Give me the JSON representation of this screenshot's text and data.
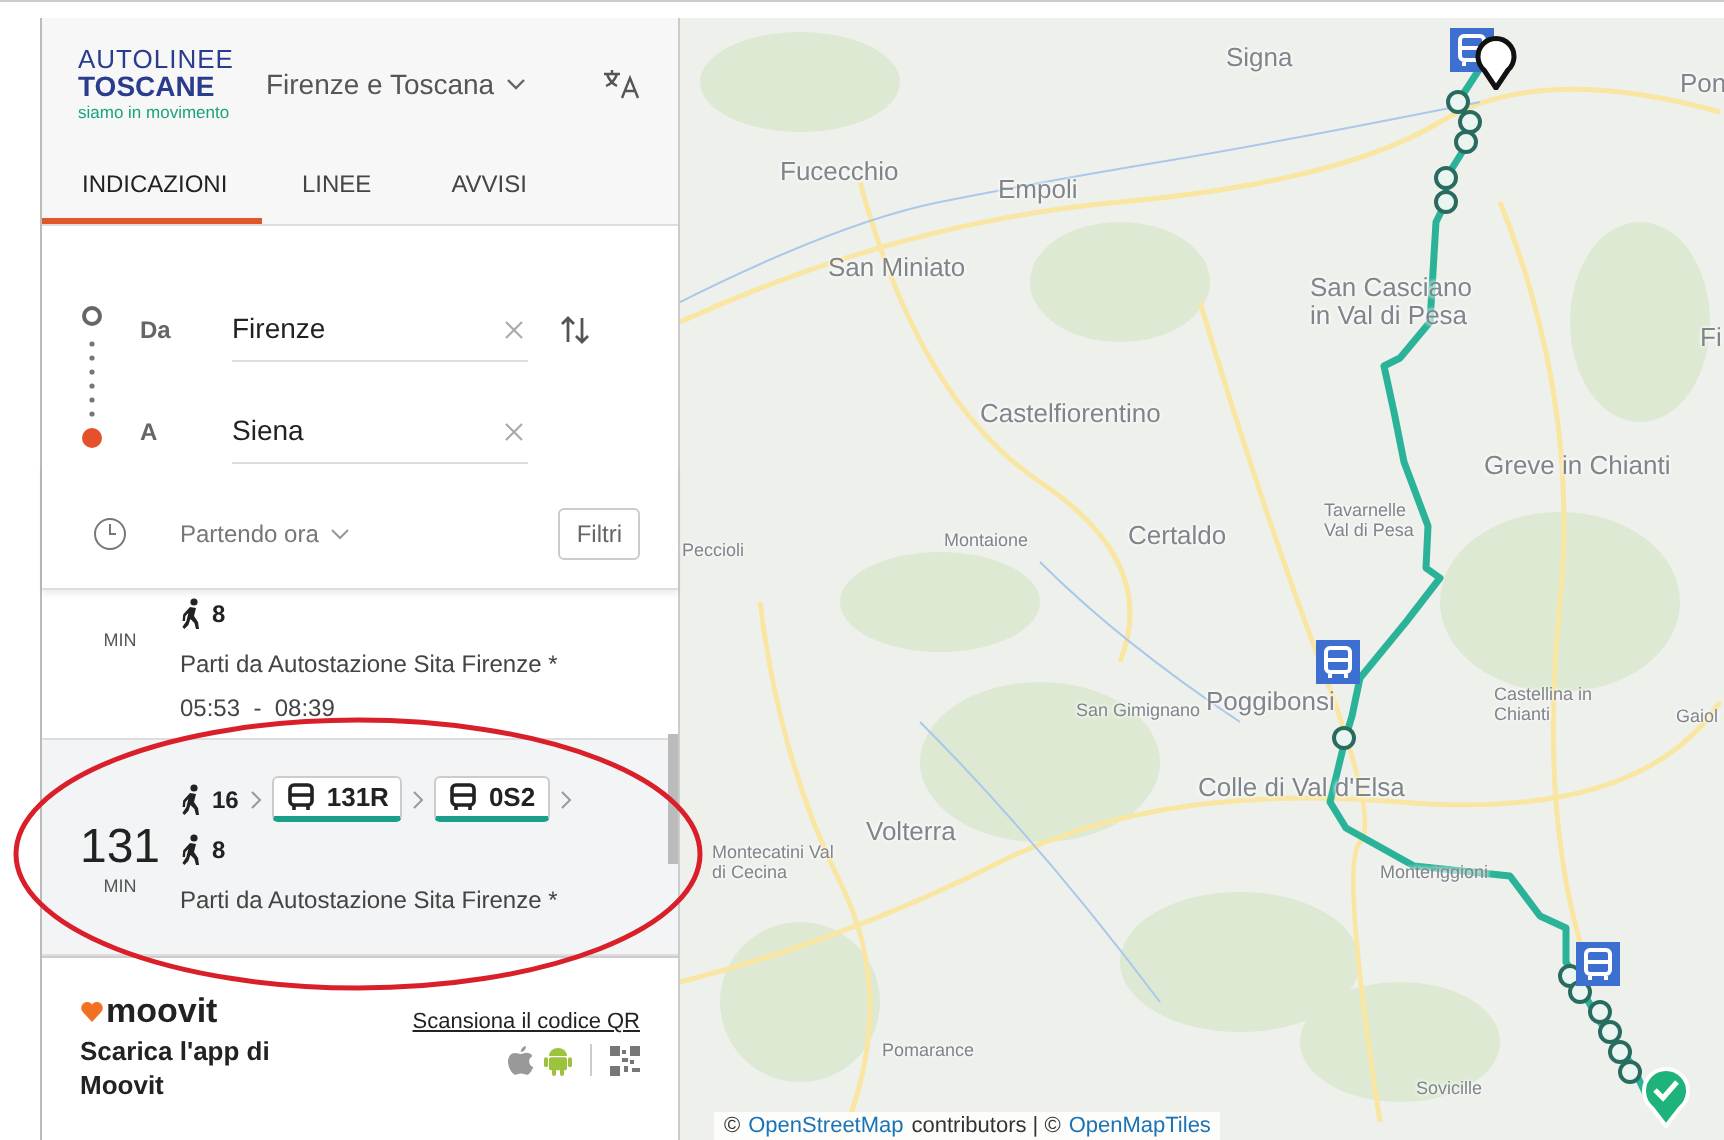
{
  "header": {
    "logo": {
      "line1": "AUTOLINEE",
      "line2": "TOSCANE",
      "tagline": "siamo in movimento"
    },
    "region": "Firenze e Toscana"
  },
  "tabs": [
    {
      "label": "INDICAZIONI",
      "selected": true
    },
    {
      "label": "LINEE",
      "selected": false
    },
    {
      "label": "AVVISI",
      "selected": false
    }
  ],
  "from": {
    "label": "Da",
    "value": "Firenze"
  },
  "to": {
    "label": "A",
    "value": "Siena"
  },
  "time": {
    "label": "Partendo ora"
  },
  "filter_button": "Filtri",
  "results": [
    {
      "unit": "MIN",
      "legs": [
        {
          "kind": "walk",
          "text": "8"
        }
      ],
      "origin": "Parti da Autostazione Sita Firenze *",
      "times": "05:53  -  08:39",
      "selected": false
    },
    {
      "duration": "131",
      "unit": "MIN",
      "legs": [
        {
          "kind": "walk",
          "text": "16"
        },
        {
          "kind": "bus",
          "text": "131R"
        },
        {
          "kind": "bus",
          "text": "0S2"
        },
        {
          "kind": "walk",
          "text": "8"
        }
      ],
      "origin": "Parti da Autostazione Sita Firenze *",
      "selected": true
    }
  ],
  "footer": {
    "brand": "moovit",
    "text": "Scarica l'app di Moovit",
    "qr_link": "Scansiona il codice QR"
  },
  "map": {
    "places": [
      {
        "name": "Signa"
      },
      {
        "name": "Fucecchio"
      },
      {
        "name": "Empoli"
      },
      {
        "name": "San Miniato"
      },
      {
        "name": "San Casciano in Val di Pesa"
      },
      {
        "name": "Castelfiorentino"
      },
      {
        "name": "Greve in Chianti"
      },
      {
        "name": "Montaione"
      },
      {
        "name": "Certaldo"
      },
      {
        "name": "Tavarnelle Val di Pesa"
      },
      {
        "name": "Peccioli"
      },
      {
        "name": "Pon"
      },
      {
        "name": "Fi"
      },
      {
        "name": "San Gimignano"
      },
      {
        "name": "Poggibonsi"
      },
      {
        "name": "Castellina in Chianti"
      },
      {
        "name": "Gaiol"
      },
      {
        "name": "Colle di Val d'Elsa"
      },
      {
        "name": "Volterra"
      },
      {
        "name": "Montecatini Val di Cecina"
      },
      {
        "name": "Monteriggioni"
      },
      {
        "name": "Pomarance"
      },
      {
        "name": "Sovicille"
      }
    ],
    "attribution": {
      "prefix": "©",
      "link1": "OpenStreetMap",
      "middle": "contributors | ©",
      "link2": "OpenMapTiles"
    }
  }
}
